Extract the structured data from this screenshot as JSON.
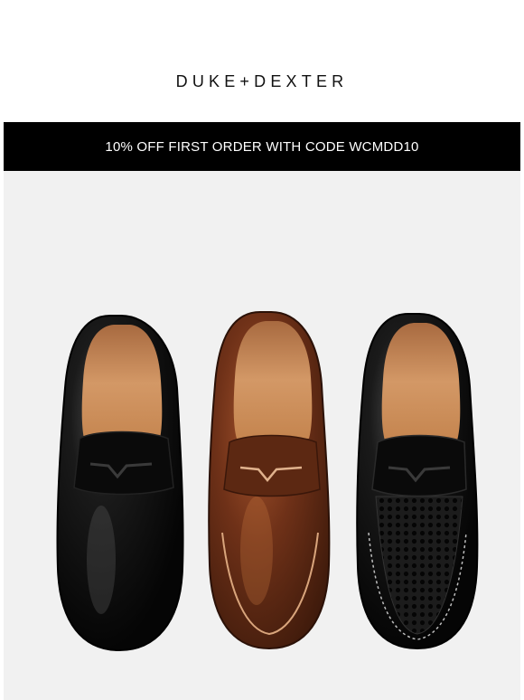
{
  "brand": {
    "logo_text": "DUKE+DEXTER"
  },
  "promo_banner": {
    "text": "10% OFF FIRST ORDER WITH CODE WCMDD10"
  },
  "hero": {
    "products": [
      {
        "name": "black-penny-loafer",
        "color": "#0d0d0d"
      },
      {
        "name": "brown-penny-loafer",
        "color": "#6b3119"
      },
      {
        "name": "black-mesh-penny-loafer",
        "color": "#111111"
      }
    ],
    "colors": {
      "background": "#f1f1f1",
      "black_leather": "#0d0d0d",
      "brown_leather": "#6b3119",
      "tan_lining": "#c98a5a"
    }
  }
}
